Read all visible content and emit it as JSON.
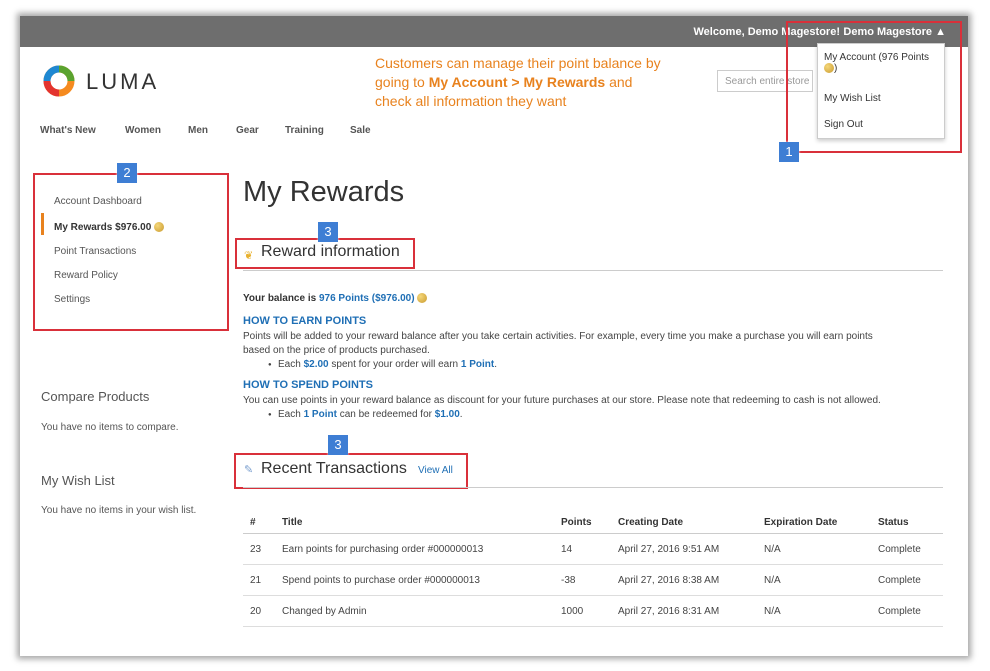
{
  "header": {
    "welcome": "Welcome, Demo Magestore!",
    "account_name": "Demo Magestore",
    "search_placeholder": "Search entire store",
    "dropdown": {
      "my_account": "My Account (976 Points",
      "my_account_tail": ")",
      "wish_list": "My Wish List",
      "sign_out": "Sign Out"
    }
  },
  "logo": {
    "text": "LUMA"
  },
  "callout": {
    "line1": "Customers can manage their point balance by",
    "line2_pre": "going to ",
    "line2_bold": "My Account > My Rewards",
    "line2_post": " and",
    "line3": "check all information they want"
  },
  "nav": [
    "What's New",
    "Women",
    "Men",
    "Gear",
    "Training",
    "Sale"
  ],
  "badges": [
    "1",
    "2",
    "3",
    "3"
  ],
  "sidebar": {
    "items": [
      "Account Dashboard",
      "My Rewards $976.00",
      "Point Transactions",
      "Reward Policy",
      "Settings"
    ],
    "compare_title": "Compare Products",
    "compare_text": "You have no items to compare.",
    "wish_title": "My Wish List",
    "wish_text": "You have no items in your wish list."
  },
  "main": {
    "title": "My Rewards",
    "reward_info_title": "Reward information",
    "balance_label": "Your balance is ",
    "balance_value": "976 Points ($976.00)",
    "earn_title": "HOW TO EARN POINTS",
    "earn_text1": "Points will be added to your reward balance after you take certain activities. For example, every time you make a purchase you will earn points",
    "earn_text2": "based on the price of products purchased.",
    "earn_bullet_pre": "Each ",
    "earn_bullet_amount": "$2.00",
    "earn_bullet_mid": " spent for your order will earn ",
    "earn_bullet_points": "1 Point",
    "earn_bullet_post": ".",
    "spend_title": "HOW TO SPEND POINTS",
    "spend_text": "You can use points in your reward balance as discount for your future purchases at our store. Please note that redeeming to cash is not allowed.",
    "spend_bullet_pre": "Each ",
    "spend_bullet_points": "1 Point",
    "spend_bullet_mid": " can be redeemed for ",
    "spend_bullet_amount": "$1.00",
    "spend_bullet_post": ".",
    "recent_title": "Recent Transactions",
    "view_all": "View All"
  },
  "transactions": {
    "headers": [
      "#",
      "Title",
      "Points",
      "Creating Date",
      "Expiration Date",
      "Status"
    ],
    "rows": [
      [
        "23",
        "Earn points for purchasing order #000000013",
        "14",
        "April 27, 2016 9:51 AM",
        "N/A",
        "Complete"
      ],
      [
        "21",
        "Spend points to purchase order #000000013",
        "-38",
        "April 27, 2016 8:38 AM",
        "N/A",
        "Complete"
      ],
      [
        "20",
        "Changed by Admin",
        "1000",
        "April 27, 2016 8:31 AM",
        "N/A",
        "Complete"
      ]
    ]
  },
  "colors": {
    "accent": "#e8821e",
    "link": "#1f6fb5",
    "highlight": "#d9303a",
    "badge": "#3e7ed4",
    "topbar": "#6e6e6e"
  }
}
